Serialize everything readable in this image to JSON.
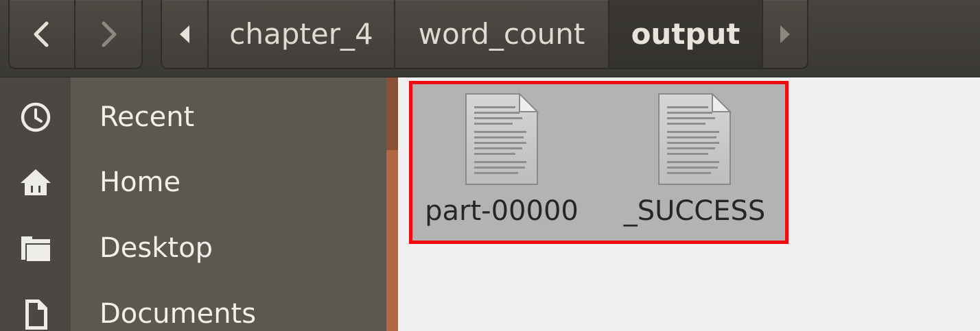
{
  "toolbar": {
    "back_icon": "chevron-left-icon",
    "forward_icon": "chevron-right-icon",
    "path_scroll_left_icon": "triangle-left-icon",
    "path_scroll_right_icon": "triangle-right-icon",
    "breadcrumbs": [
      {
        "label": "chapter_4",
        "current": false
      },
      {
        "label": "word_count",
        "current": false
      },
      {
        "label": "output",
        "current": true
      }
    ]
  },
  "sidebar": {
    "items": [
      {
        "label": "Recent",
        "icon": "clock-icon"
      },
      {
        "label": "Home",
        "icon": "home-icon"
      },
      {
        "label": "Desktop",
        "icon": "folder-icon"
      },
      {
        "label": "Documents",
        "icon": "document-icon"
      }
    ]
  },
  "files": [
    {
      "name": "part-00000",
      "icon": "text-file-icon",
      "selected": true
    },
    {
      "name": "_SUCCESS",
      "icon": "text-file-icon",
      "selected": true
    }
  ],
  "colors": {
    "header_bg": "#3f3c38",
    "sidebar_bg": "#5b5850",
    "content_bg": "#f1f0ee",
    "selection_bg": "#b3b3b3",
    "highlight_border": "#f10a10"
  }
}
